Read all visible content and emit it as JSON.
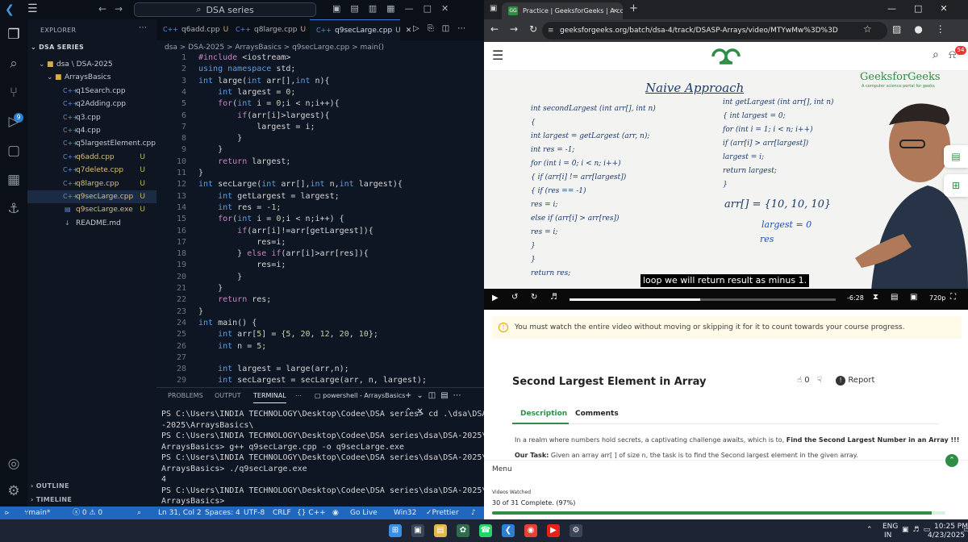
{
  "vscode": {
    "search": "DSA series",
    "explorer_title": "EXPLORER",
    "workspace": "DSA SERIES",
    "tree": [
      {
        "label": "dsa \\ DSA-2025",
        "kind": "folder",
        "status": ""
      },
      {
        "label": "ArraysBasics",
        "kind": "folder",
        "status": ""
      },
      {
        "label": "q1Search.cpp",
        "kind": "cpp",
        "status": ""
      },
      {
        "label": "q2Adding.cpp",
        "kind": "cpp",
        "status": ""
      },
      {
        "label": "q3.cpp",
        "kind": "cpp",
        "status": ""
      },
      {
        "label": "q4.cpp",
        "kind": "cpp",
        "status": ""
      },
      {
        "label": "q5largestElement.cpp",
        "kind": "cpp",
        "status": ""
      },
      {
        "label": "q6add.cpp",
        "kind": "cpp",
        "status": "U"
      },
      {
        "label": "q7delete.cpp",
        "kind": "cpp",
        "status": "U"
      },
      {
        "label": "q8large.cpp",
        "kind": "cpp",
        "status": "U"
      },
      {
        "label": "q9secLarge.cpp",
        "kind": "cpp",
        "status": "U"
      },
      {
        "label": "q9secLarge.exe",
        "kind": "exe",
        "status": "U"
      },
      {
        "label": "README.md",
        "kind": "md",
        "status": ""
      }
    ],
    "outline": "OUTLINE",
    "timeline": "TIMELINE",
    "tabs": [
      {
        "label": "q6add.cpp",
        "status": "U"
      },
      {
        "label": "q8large.cpp",
        "status": "U"
      },
      {
        "label": "q9secLarge.cpp",
        "status": "U"
      }
    ],
    "breadcrumbs": "dsa > DSA-2025 > ArraysBasics > q9secLarge.cpp > main()",
    "code_lines": [
      "#include <iostream>",
      "using namespace std;",
      "int large(int arr[],int n){",
      "    int largest = 0;",
      "    for(int i = 0;i < n;i++){",
      "        if(arr[i]>largest){",
      "            largest = i;",
      "        }",
      "    }",
      "    return largest;",
      "}",
      "int secLarge(int arr[],int n,int largest){",
      "    int getLargest = largest;",
      "    int res = -1;",
      "    for(int i = 0;i < n;i++) {",
      "        if(arr[i]!=arr[getLargest]){",
      "            res=i;",
      "        } else if(arr[i]>arr[res]){",
      "            res=i;",
      "        }",
      "    }",
      "    return res;",
      "}",
      "int main() {",
      "    int arr[5] = {5, 20, 12, 20, 10};",
      "    int n = 5;",
      "",
      "    int largest = large(arr,n);",
      "    int secLargest = secLarge(arr, n, largest);"
    ],
    "panel_tabs": [
      "PROBLEMS",
      "OUTPUT",
      "TERMINAL"
    ],
    "terminal_name": "powershell - ArraysBasics",
    "terminal_lines": [
      "PS C:\\Users\\INDIA TECHNOLOGY\\Desktop\\Codee\\DSA series> cd .\\dsa\\DSA",
      "-2025\\ArraysBasics\\",
      "PS C:\\Users\\INDIA TECHNOLOGY\\Desktop\\Codee\\DSA series\\dsa\\DSA-2025\\",
      "ArraysBasics> g++ q9secLarge.cpp -o q9secLarge.exe",
      "PS C:\\Users\\INDIA TECHNOLOGY\\Desktop\\Codee\\DSA series\\dsa\\DSA-2025\\",
      "ArraysBasics> ./q9secLarge.exe",
      "4",
      "PS C:\\Users\\INDIA TECHNOLOGY\\Desktop\\Codee\\DSA series\\dsa\\DSA-2025\\",
      "ArraysBasics> "
    ],
    "status": {
      "branch": "main*",
      "problems": "ⓧ 0 ⚠ 0",
      "cursor": "Ln 31, Col 2",
      "spaces": "Spaces: 4",
      "encoding": "UTF-8",
      "eol": "CRLF",
      "language": "{} C++",
      "golive": "Go Live",
      "platform": "Win32",
      "prettier": "Prettier"
    },
    "accent": "#1f67bf"
  },
  "browser": {
    "tab_title": "Practice | GeeksforGeeks | A com",
    "url": "geeksforgeeks.org/batch/dsa-4/track/DSASP-Arrays/video/MTYwMw%3D%3D",
    "notification_count": "54",
    "video": {
      "watermark": "GeeksforGeeks",
      "watermark_sub": "A computer science portal for geeks",
      "board_title": "Naive Approach",
      "left_code": [
        "int secondLargest (int arr[], int n)",
        "{",
        "  int largest = getLargest (arr, n);",
        "  int res = -1;",
        "  for (int i = 0; i < n; i++)",
        "  {  if (arr[i] != arr[largest])",
        "     {  if (res == -1)",
        "          res = i;",
        "        else if (arr[i] > arr[res])",
        "          res = i;",
        "     }",
        "  }",
        "  return res;"
      ],
      "right_code": [
        "int getLargest (int arr[], int n)",
        "{  int largest = 0;",
        "   for (int i = 1; i < n; i++)",
        "      if (arr[i] > arr[largest])",
        "         largest = i;",
        "   return largest;",
        "}"
      ],
      "example": "arr[] = {10, 10, 10}",
      "example_2": "largest = 0",
      "example_3": "res",
      "caption": "loop we will return result as minus 1.",
      "time": "-6:28",
      "quality": "720p",
      "progress": 0.49
    },
    "notice": "You must watch the entire video without moving or skipping it for it to count towards your course progress.",
    "problem_title": "Second Largest Element in Array",
    "likes": "0",
    "report": "Report",
    "tabs": [
      "Description",
      "Comments"
    ],
    "desc_intro": "In a realm where numbers hold secrets, a captivating challenge awaits, which is to,",
    "desc_bold": "Find the Second Largest Number in an Array !!!",
    "task_label": "Our Task:",
    "task_text": "Given an array arr[ ] of size n, the task is to find the Second largest element in the given array.",
    "menu": "Menu",
    "videos_watched_label": "Videos Watched",
    "videos_watched": "30 of 31 Complete. (97%)",
    "watched_progress": 0.97,
    "accent": "#2f8d46"
  },
  "taskbar": {
    "lang": "ENG",
    "region": "IN",
    "time": "10:25 PM",
    "date": "4/23/2025"
  }
}
